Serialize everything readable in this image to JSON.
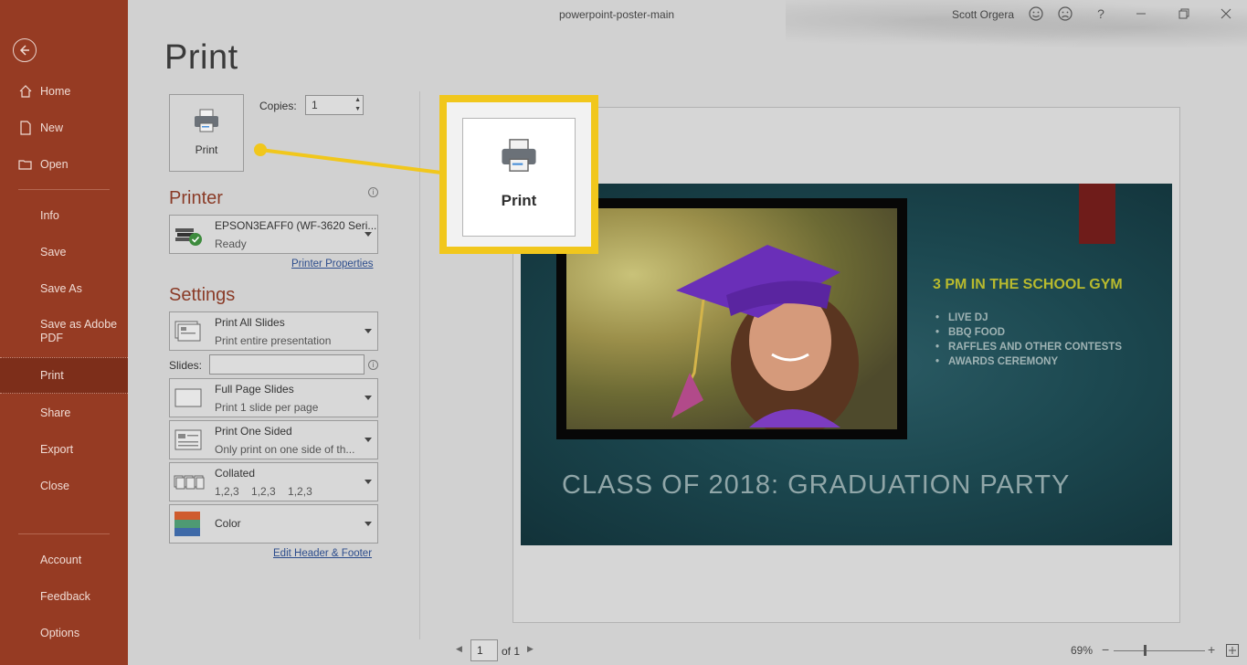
{
  "titlebar": {
    "document_title": "powerpoint-poster-main",
    "user_name": "Scott Orgera",
    "help": "?"
  },
  "sidebar": {
    "items": [
      {
        "label": "Home",
        "icon": "home-icon"
      },
      {
        "label": "New",
        "icon": "new-document-icon"
      },
      {
        "label": "Open",
        "icon": "open-folder-icon"
      },
      {
        "label": "Info"
      },
      {
        "label": "Save"
      },
      {
        "label": "Save As"
      },
      {
        "label": "Save as Adobe PDF"
      },
      {
        "label": "Print"
      },
      {
        "label": "Share"
      },
      {
        "label": "Export"
      },
      {
        "label": "Close"
      },
      {
        "label": "Account"
      },
      {
        "label": "Feedback"
      },
      {
        "label": "Options"
      }
    ],
    "active": "Print"
  },
  "print_panel": {
    "title": "Print",
    "print_button_label": "Print",
    "copies_label": "Copies:",
    "copies_value": "1",
    "printer_heading": "Printer",
    "printer_name": "EPSON3EAFF0 (WF-3620 Seri...",
    "printer_status": "Ready",
    "printer_properties_link": "Printer Properties",
    "settings_heading": "Settings",
    "settings": [
      {
        "title": "Print All Slides",
        "subtitle": "Print entire presentation"
      },
      {
        "title": "Full Page Slides",
        "subtitle": "Print 1 slide per page"
      },
      {
        "title": "Print One Sided",
        "subtitle": "Only print on one side of th..."
      },
      {
        "title": "Collated",
        "subtitle": "1,2,3    1,2,3    1,2,3"
      },
      {
        "title": "Color",
        "subtitle": ""
      }
    ],
    "slides_label": "Slides:",
    "slides_value": "",
    "edit_header_footer_link": "Edit Header & Footer"
  },
  "callout": {
    "label": "Print",
    "accent_color": "#f1c71c"
  },
  "slide": {
    "heading": "3 PM IN THE SCHOOL GYM",
    "bullets": [
      "LIVE DJ",
      "BBQ FOOD",
      "RAFFLES AND OTHER CONTESTS",
      "AWARDS CEREMONY"
    ],
    "title": "CLASS OF 2018:  GRADUATION PARTY",
    "heading_color": "#b8ba2e"
  },
  "footer": {
    "page_value": "1",
    "of_label": "of 1",
    "zoom": "69%"
  },
  "colors": {
    "sidebar": "#963b23",
    "section_heading": "#8a3b27",
    "link": "#2b4c8c"
  }
}
